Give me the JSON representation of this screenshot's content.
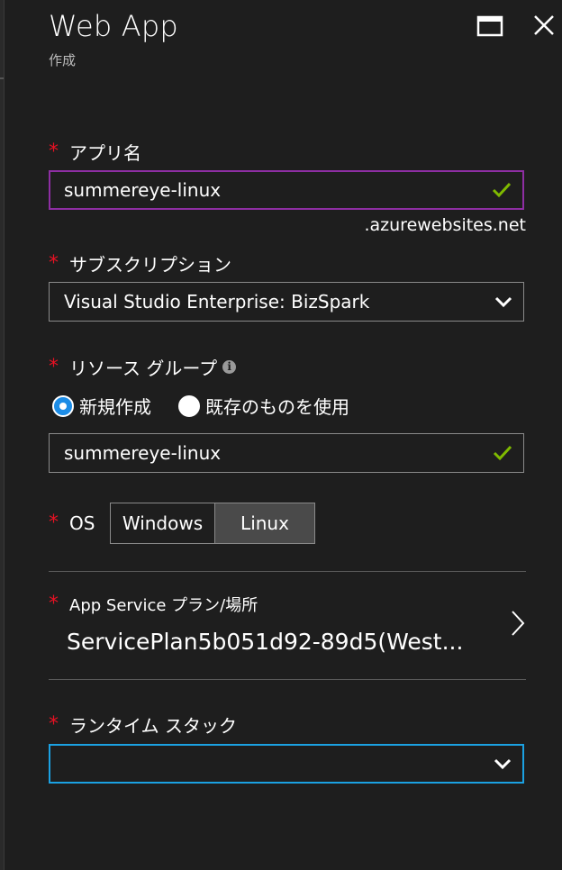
{
  "blade": {
    "title": "Web App",
    "subtitle": "作成"
  },
  "app_name": {
    "label": "アプリ名",
    "value": "summereye-linux",
    "suffix": ".azurewebsites.net"
  },
  "subscription": {
    "label": "サブスクリプション",
    "selected": "Visual Studio Enterprise: BizSpark"
  },
  "resource_group": {
    "label": "リソース グループ",
    "option_new": "新規作成",
    "option_existing": "既存のものを使用",
    "selected_option": "new",
    "value": "summereye-linux"
  },
  "os": {
    "label": "OS",
    "options": [
      "Windows",
      "Linux"
    ],
    "selected": "Linux"
  },
  "app_service_plan": {
    "label": "App Service プラン/場所",
    "value": "ServicePlan5b051d92-89d5(West..."
  },
  "runtime_stack": {
    "label": "ランタイム スタック",
    "selected": ""
  },
  "colors": {
    "background": "#1e1e1e",
    "required_marker": "#e81123",
    "valid_check": "#7fba00",
    "active_border": "#8e2ea3",
    "focus_border": "#1ba1e2",
    "radio_selected": "#1c8ce6"
  }
}
